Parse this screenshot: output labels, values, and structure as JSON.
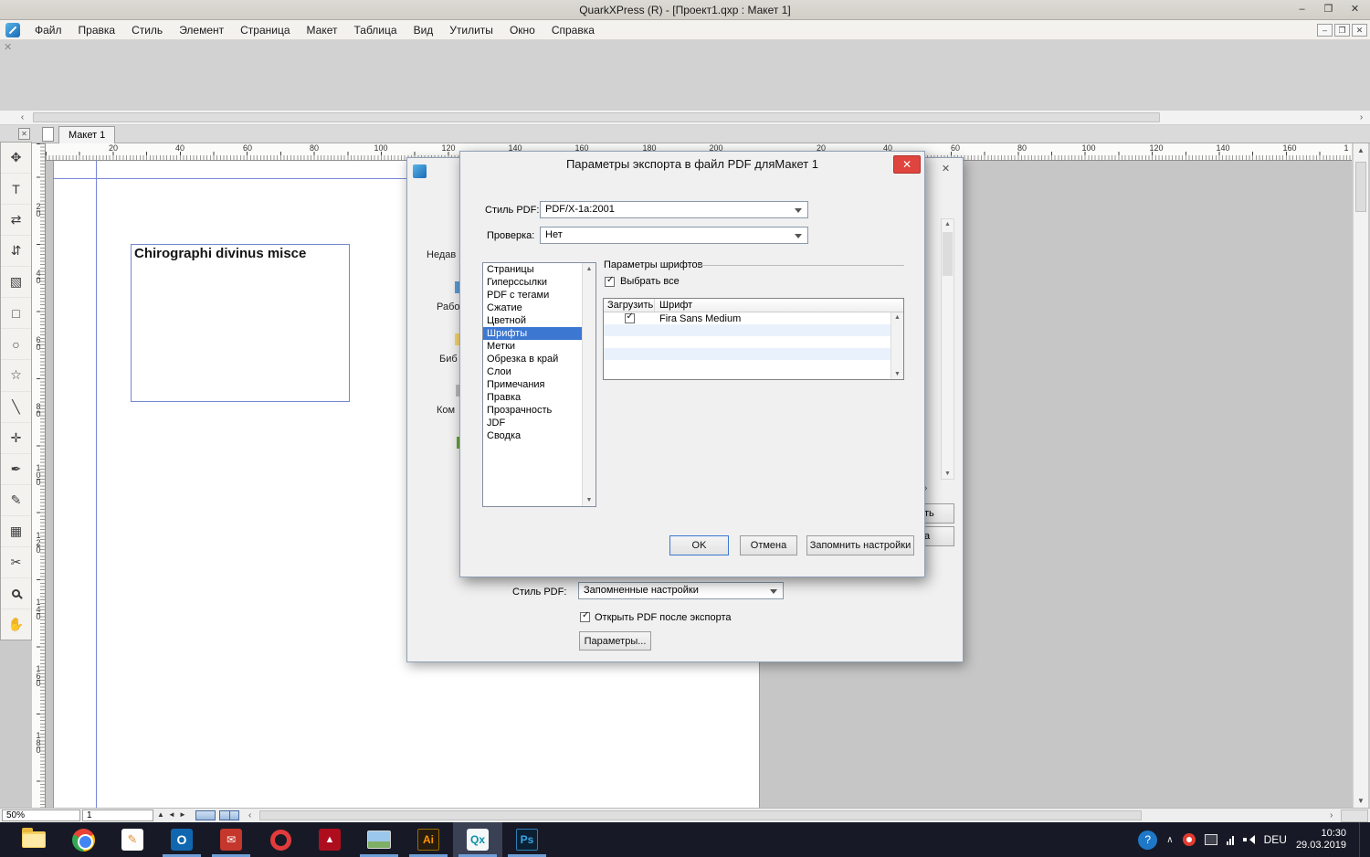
{
  "titlebar": {
    "title": "QuarkXPress (R) - [Проект1.qxp : Макет 1]",
    "minimize_glyph": "–",
    "restore_glyph": "❐",
    "close_glyph": "✕"
  },
  "menubar": {
    "items": [
      "Файл",
      "Правка",
      "Стиль",
      "Элемент",
      "Страница",
      "Макет",
      "Таблица",
      "Вид",
      "Утилиты",
      "Окно",
      "Справка"
    ],
    "mdi_minimize_glyph": "–",
    "mdi_restore_glyph": "❐",
    "mdi_close_glyph": "✕"
  },
  "document": {
    "tab_label": "Макет 1",
    "frame_text": "Chirographi divinus misce"
  },
  "rulers": {
    "horizontal": [
      "20",
      "40",
      "60",
      "80",
      "100",
      "120",
      "140",
      "160",
      "180",
      "200",
      "20",
      "40",
      "60",
      "80",
      "100",
      "120",
      "140",
      "160",
      "1"
    ],
    "vertical": [
      "20",
      "40",
      "60",
      "80",
      "100",
      "120",
      "140",
      "160",
      "180"
    ]
  },
  "tools": [
    {
      "name": "item-tool",
      "glyph": "✥"
    },
    {
      "name": "text-content-tool",
      "glyph": "T"
    },
    {
      "name": "text-linking-tool",
      "glyph": "⇄"
    },
    {
      "name": "text-unlinking-tool",
      "glyph": "⇵"
    },
    {
      "name": "picture-content-tool",
      "glyph": "▧"
    },
    {
      "name": "rectangle-box-tool",
      "glyph": "□"
    },
    {
      "name": "oval-box-tool",
      "glyph": "○"
    },
    {
      "name": "starburst-tool",
      "glyph": "☆"
    },
    {
      "name": "line-tool",
      "glyph": "╲"
    },
    {
      "name": "composition-zones-tool",
      "glyph": "✛"
    },
    {
      "name": "bezier-pen-tool",
      "glyph": "✒"
    },
    {
      "name": "freehand-line-tool",
      "glyph": "✎"
    },
    {
      "name": "tables-tool",
      "glyph": "▦"
    },
    {
      "name": "scissors-tool",
      "glyph": "✂"
    },
    {
      "name": "zoom-tool",
      "glyph": ""
    },
    {
      "name": "pan-tool",
      "glyph": "✋"
    }
  ],
  "export_dialog": {
    "title": "Параметры экспорта в файл PDF дляМакет 1",
    "close_glyph": "✕",
    "pdf_style_label": "Стиль PDF:",
    "pdf_style_value": "PDF/X-1a:2001",
    "verification_label": "Проверка:",
    "verification_value": "Нет",
    "sections": [
      "Страницы",
      "Гиперссылки",
      "PDF с тегами",
      "Сжатие",
      "Цветной",
      "Шрифты",
      "Метки",
      "Обрезка в край",
      "Слои",
      "Примечания",
      "Правка",
      "Прозрачность",
      "JDF",
      "Сводка"
    ],
    "selected_section": "Шрифты",
    "fonts_group_title": "Параметры шрифтов",
    "select_all_label": "Выбрать все",
    "table_col_download": "Загрузить",
    "table_col_font": "Шрифт",
    "font_row_name": "Fira Sans Medium",
    "ok_label": "OK",
    "cancel_label": "Отмена",
    "remember_label": "Запомнить настройки"
  },
  "save_dialog": {
    "close_glyph": "✕",
    "sidebar_fragments": [
      "Недав",
      "Рабо",
      "Биб",
      "Ком"
    ],
    "save_button_fragment": "ть",
    "cancel_button_fragment": "а",
    "pdf_style_label": "Стиль PDF:",
    "pdf_style_value": "Запомненные настройки",
    "open_after_export_label": "Открыть PDF после экспорта",
    "options_button_label": "Параметры..."
  },
  "statusbar": {
    "zoom_value": "50%",
    "page_number": "1"
  },
  "taskbar": {
    "apps": [
      {
        "name": "file-explorer",
        "glyph": "",
        "running": false
      },
      {
        "name": "chrome",
        "glyph": "",
        "running": false
      },
      {
        "name": "text-editor",
        "glyph": "✎",
        "running": false
      },
      {
        "name": "outlook",
        "glyph": "O",
        "running": true
      },
      {
        "name": "mail",
        "glyph": "✉",
        "running": true
      },
      {
        "name": "opera",
        "glyph": "",
        "running": false
      },
      {
        "name": "acrobat-reader",
        "glyph": "▲",
        "running": false
      },
      {
        "name": "photo-viewer",
        "glyph": "",
        "running": true
      },
      {
        "name": "illustrator",
        "glyph": "Ai",
        "running": true
      },
      {
        "name": "quarkxpress",
        "glyph": "Qx",
        "running": true,
        "active": true
      },
      {
        "name": "photoshop",
        "glyph": "Ps",
        "running": true
      }
    ],
    "tray": {
      "help_glyph": "?",
      "caret_glyph": "∧",
      "language": "DEU",
      "time": "10:30",
      "date": "29.03.2019"
    }
  },
  "colors": {
    "selection_blue": "#3c77d2",
    "close_red": "#e0443e",
    "taskbar_bg": "#171a26",
    "guide_blue": "#7b86d8",
    "running_underline": "#6f9fd8"
  }
}
